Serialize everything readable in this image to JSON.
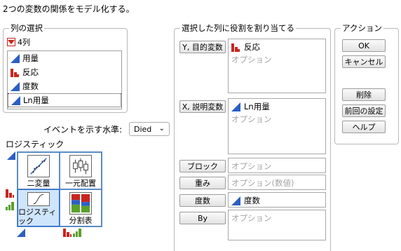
{
  "header": {
    "title": "2つの変数の関係をモデル化する。"
  },
  "columns_panel": {
    "legend": "列の選択",
    "count_label": "4列",
    "columns": [
      {
        "label": "用量",
        "icon": "continuous-icon"
      },
      {
        "label": "反応",
        "icon": "nominal-icon"
      },
      {
        "label": "度数",
        "icon": "continuous-icon"
      },
      {
        "label": "Ln用量",
        "icon": "continuous-icon",
        "selected": true
      }
    ]
  },
  "event_level": {
    "label": "イベントを示す水準:",
    "value": "Died"
  },
  "platform_grid": {
    "label": "ロジスティック",
    "cells": [
      {
        "label": "二変量"
      },
      {
        "label": "一元配置"
      },
      {
        "label": "ロジスティック",
        "selected": true
      },
      {
        "label": "分割表"
      }
    ]
  },
  "cast_panel": {
    "legend": "選択した列に役割を割り当てる",
    "roles": {
      "y": {
        "button": "Y, 目的変数",
        "entry": "反応",
        "placeholder": "オプション"
      },
      "x": {
        "button": "X, 説明変数",
        "entry": "Ln用量",
        "placeholder": "オプション"
      },
      "block": {
        "button": "ブロック",
        "placeholder": "オプション"
      },
      "weight": {
        "button": "重み",
        "placeholder": "オプション(数値)"
      },
      "freq": {
        "button": "度数",
        "entry": "度数"
      },
      "by": {
        "button": "By",
        "placeholder": "オプション"
      }
    }
  },
  "actions_panel": {
    "legend": "アクション",
    "ok": "OK",
    "cancel": "キャンセル",
    "remove": "削除",
    "recall": "前回の設定",
    "help": "ヘルプ"
  },
  "colors": {
    "continuous": "#2b5fc5",
    "nominal": "#c8261d",
    "selection": "#cfe5fb"
  }
}
